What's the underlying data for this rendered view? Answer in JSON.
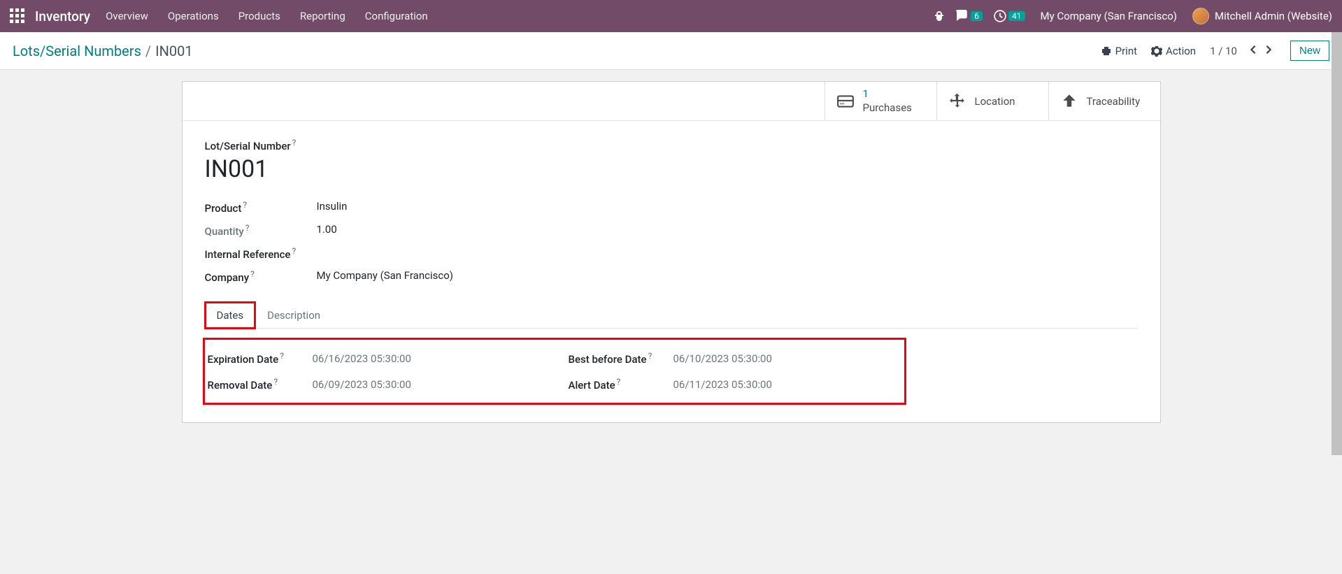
{
  "nav": {
    "brand": "Inventory",
    "links": [
      "Overview",
      "Operations",
      "Products",
      "Reporting",
      "Configuration"
    ],
    "messages_count": "6",
    "activities_count": "41",
    "company": "My Company (San Francisco)",
    "user": "Mitchell Admin (Website)"
  },
  "cp": {
    "breadcrumb_root": "Lots/Serial Numbers",
    "breadcrumb_current": "IN001",
    "print": "Print",
    "action": "Action",
    "pager": "1 / 10",
    "new_btn": "New"
  },
  "stats": {
    "purchases_count": "1",
    "purchases_label": "Purchases",
    "location": "Location",
    "traceability": "Traceability"
  },
  "form": {
    "lot_label": "Lot/Serial Number",
    "lot_value": "IN001",
    "product_label": "Product",
    "product_value": "Insulin",
    "quantity_label": "Quantity",
    "quantity_value": "1.00",
    "internal_ref_label": "Internal Reference",
    "company_label": "Company",
    "company_value": "My Company (San Francisco)"
  },
  "tabs": {
    "dates": "Dates",
    "description": "Description"
  },
  "dates": {
    "expiration_label": "Expiration Date",
    "expiration_value": "06/16/2023 05:30:00",
    "best_before_label": "Best before Date",
    "best_before_value": "06/10/2023 05:30:00",
    "removal_label": "Removal Date",
    "removal_value": "06/09/2023 05:30:00",
    "alert_label": "Alert Date",
    "alert_value": "06/11/2023 05:30:00"
  }
}
